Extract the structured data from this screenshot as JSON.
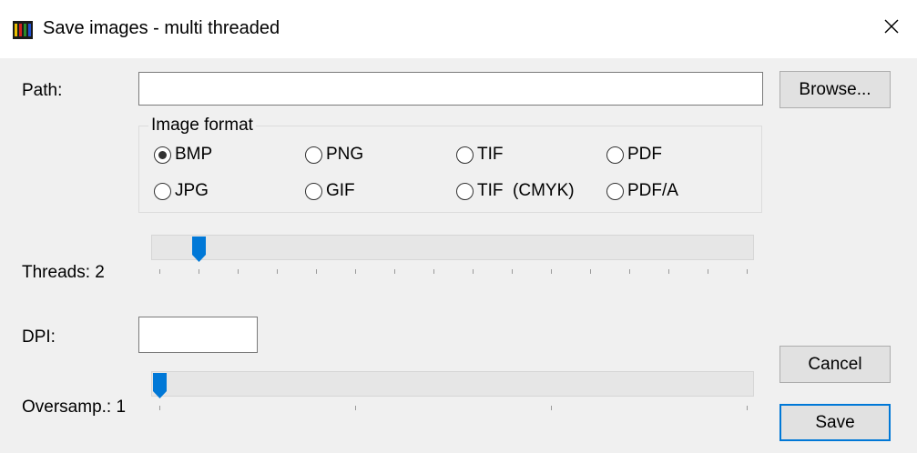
{
  "window": {
    "title": "Save images - multi threaded"
  },
  "path": {
    "label": "Path:",
    "value": "",
    "browse_label": "Browse..."
  },
  "image_format": {
    "title": "Image format",
    "options": [
      "BMP",
      "PNG",
      "TIF",
      "PDF",
      "JPG",
      "GIF",
      "TIF  (CMYK)",
      "PDF/A"
    ],
    "selected": "BMP"
  },
  "threads": {
    "label": "Threads: 2",
    "value": 2,
    "min": 1,
    "max": 16
  },
  "dpi": {
    "label": "DPI:",
    "value": ""
  },
  "oversamp": {
    "label": "Oversamp.: 1",
    "value": 1,
    "min": 1,
    "max": 4
  },
  "buttons": {
    "cancel": "Cancel",
    "save": "Save"
  },
  "colors": {
    "accent": "#0078d7",
    "titlebar": "#ffffff",
    "background": "#f0f0f0"
  },
  "icons": {
    "app": "filmstrip-icon",
    "close": "close-icon",
    "slider_thumb": "slider-thumb-icon"
  }
}
